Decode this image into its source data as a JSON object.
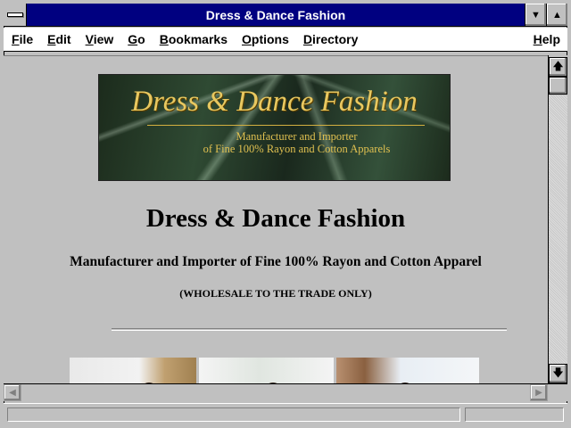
{
  "window": {
    "title": "Dress & Dance Fashion"
  },
  "titlebar_buttons": {
    "minimize": "▼",
    "maximize": "▲"
  },
  "menu": {
    "items": [
      {
        "first": "F",
        "rest": "ile"
      },
      {
        "first": "E",
        "rest": "dit"
      },
      {
        "first": "V",
        "rest": "iew"
      },
      {
        "first": "G",
        "rest": "o"
      },
      {
        "first": "B",
        "rest": "ookmarks"
      },
      {
        "first": "O",
        "rest": "ptions"
      },
      {
        "first": "D",
        "rest": "irectory"
      }
    ],
    "help": {
      "first": "H",
      "rest": "elp"
    }
  },
  "page": {
    "banner": {
      "title": "Dress & Dance Fashion",
      "subtitle_line1": "Manufacturer and Importer",
      "subtitle_line2": "of Fine 100% Rayon and Cotton Apparels"
    },
    "heading": "Dress & Dance Fashion",
    "subheading": "Manufacturer and Importer of Fine 100% Rayon and Cotton Apparel",
    "note": "(WHOLESALE TO THE TRADE ONLY)"
  },
  "scrollbar": {
    "up": "🡅",
    "down": "🡇",
    "left": "◀",
    "right": "▶"
  },
  "status": {
    "message": ""
  }
}
